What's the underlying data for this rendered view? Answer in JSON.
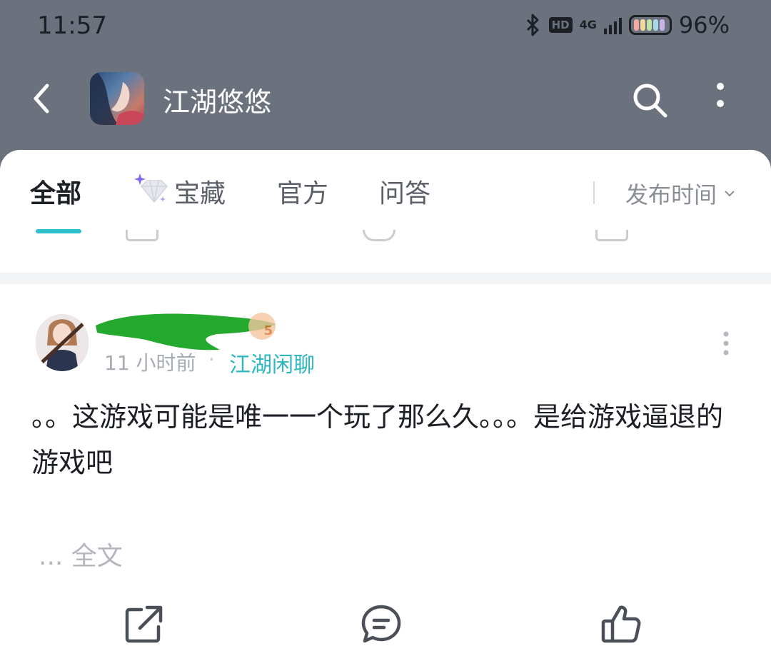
{
  "status_bar": {
    "time": "11:57",
    "hd": "HD",
    "network": "4G",
    "battery": "96%",
    "battery_level": 0.96
  },
  "header": {
    "title": "江湖悠悠",
    "back_icon": "chevron-left-icon",
    "search_icon": "search-icon",
    "more_icon": "more-vertical-icon"
  },
  "tabs": [
    {
      "label": "全部",
      "active": true
    },
    {
      "label": "宝藏",
      "active": false,
      "icon": "gem-icon"
    },
    {
      "label": "官方",
      "active": false
    },
    {
      "label": "问答",
      "active": false
    }
  ],
  "sort": {
    "label": "发布时间",
    "icon": "chevron-down-icon"
  },
  "post": {
    "username": "",
    "level": "5",
    "time": "11 小时前",
    "separator": "·",
    "category": "江湖闲聊",
    "body": "。。这游戏可能是唯一一个玩了那么久。。。是给游戏逼退的游戏吧",
    "read_more": "... 全文",
    "actions": [
      {
        "name": "share",
        "icon": "share-icon"
      },
      {
        "name": "comment",
        "icon": "comment-icon"
      },
      {
        "name": "like",
        "icon": "thumbs-up-icon"
      }
    ]
  },
  "colors": {
    "header_bg": "#6b717d",
    "accent": "#2dc0c8",
    "text_primary": "#1c1f24",
    "text_muted": "#a8adb3"
  }
}
